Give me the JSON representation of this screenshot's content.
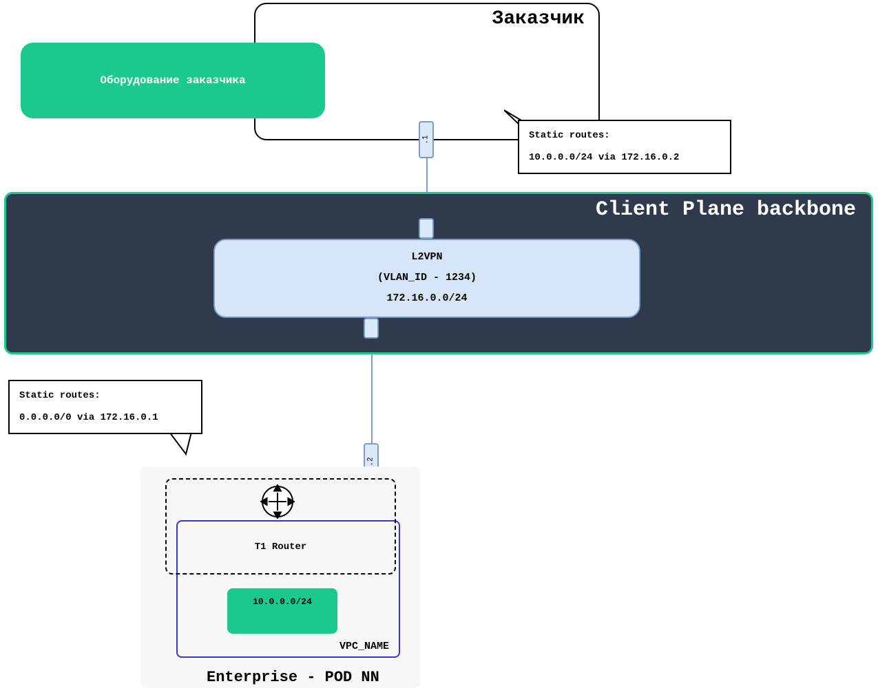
{
  "customer": {
    "title": "Заказчик",
    "equipment_label": "Оборудование заказчика",
    "port_label": ".1",
    "routes_title": "Static routes:",
    "routes_line": "10.0.0.0/24 via 172.16.0.2"
  },
  "backbone": {
    "title": "Client Plane backbone",
    "l2vpn_line1": "L2VPN",
    "l2vpn_line2": "(VLAN_ID - 1234)",
    "l2vpn_line3": "172.16.0.0/24"
  },
  "enterprise": {
    "port_label": ".2",
    "routes_title": "Static routes:",
    "routes_line": "0.0.0.0/0 via 172.16.0.1",
    "t1_label": "T1 Router",
    "vpc_label": "VPC_NAME",
    "subnet": "10.0.0.0/24",
    "pod_label": "Enterprise - POD NN"
  }
}
